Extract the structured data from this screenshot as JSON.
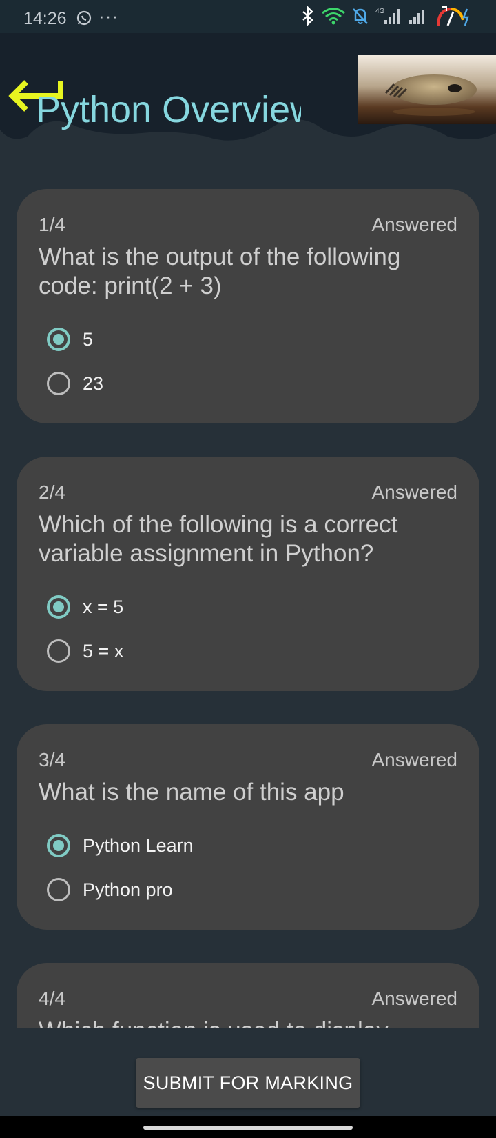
{
  "status_bar": {
    "time": "14:26",
    "dots": "···",
    "icons": [
      "whatsapp-icon",
      "bluetooth-icon",
      "wifi-icon",
      "bell-off-icon",
      "signal-4g-icon",
      "signal-icon",
      "battery-charging-icon"
    ],
    "network_label": "4G"
  },
  "header": {
    "title": "Python Overview",
    "back_icon": "back-arrow-icon",
    "accent_color": "#e7f520",
    "title_color": "#86d7df"
  },
  "questions": [
    {
      "number": "1/4",
      "status": "Answered",
      "text": "What is the output of the following code: print(2 + 3)",
      "options": [
        {
          "label": "5",
          "selected": true
        },
        {
          "label": "23",
          "selected": false
        }
      ]
    },
    {
      "number": "2/4",
      "status": "Answered",
      "text": "Which of the following is a correct variable assignment in Python?",
      "options": [
        {
          "label": "x = 5",
          "selected": true
        },
        {
          "label": "5 = x",
          "selected": false
        }
      ]
    },
    {
      "number": "3/4",
      "status": "Answered",
      "text": "What is the name of this app",
      "options": [
        {
          "label": "Python Learn",
          "selected": true
        },
        {
          "label": "Python pro",
          "selected": false
        }
      ]
    },
    {
      "number": "4/4",
      "status": "Answered",
      "text": "Which function is used to display"
    }
  ],
  "submit_label": "SUBMIT FOR MARKING",
  "colors": {
    "background": "#263038",
    "card": "#424242",
    "radio_selected": "#80cbc4"
  }
}
